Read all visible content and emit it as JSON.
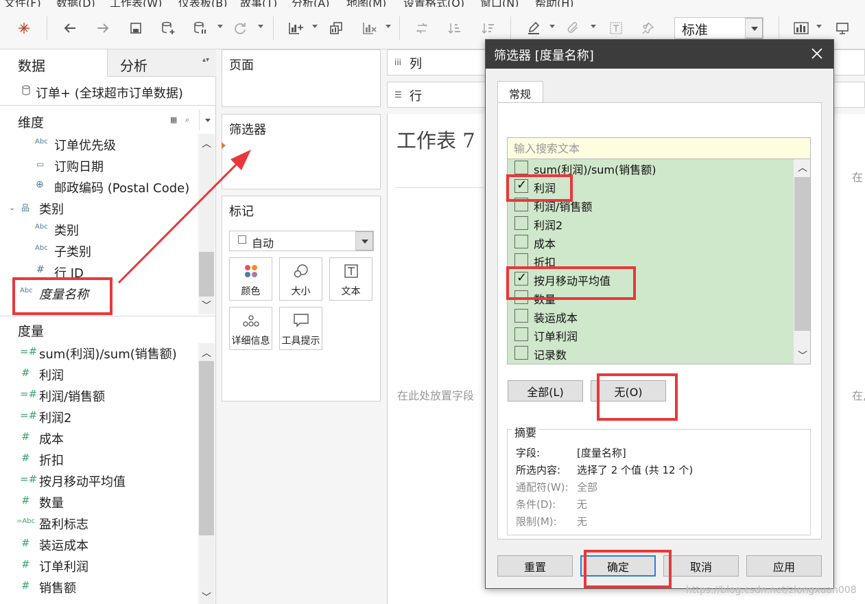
{
  "menubar": {
    "items": [
      "文件(F)",
      "数据(D)",
      "工作表(W)",
      "仪表板(B)",
      "故事(T)",
      "分析(A)",
      "地图(M)",
      "设置格式(O)",
      "窗口(N)",
      "帮助(H)"
    ]
  },
  "toolbar": {
    "icons": [
      "tableau-logo-icon",
      "back-arrow-icon",
      "forward-arrow-icon",
      "save-icon",
      "new-datasource-icon",
      "pause-update-icon",
      "refresh-icon",
      "new-worksheet-icon",
      "duplicate-icon",
      "clear-icon",
      "swap-icon",
      "sort-asc-icon",
      "sort-desc-icon",
      "highlight-icon",
      "annotate-icon",
      "label-icon",
      "pin-icon",
      "show-me-icon",
      "presentation-icon"
    ],
    "fit_select": "标准"
  },
  "left_pane": {
    "tab_data": "数据",
    "tab_analysis": "分析",
    "datasource": "订单+ (全球超市订单数据)",
    "dimensions_title": "维度",
    "dimensions": [
      {
        "icon": "Abc",
        "label": "订单优先级"
      },
      {
        "icon": "calendar",
        "label": "订购日期"
      },
      {
        "icon": "globe",
        "label": "邮政编码 (Postal Code)"
      },
      {
        "icon": "hierarchy",
        "label": "类别"
      },
      {
        "icon": "Abc",
        "label": "类别"
      },
      {
        "icon": "Abc",
        "label": "子类别"
      },
      {
        "icon": "#",
        "label": "行 ID"
      },
      {
        "icon": "Abc",
        "label": "度量名称"
      }
    ],
    "measures_title": "度量",
    "measures": [
      {
        "icon": "=#",
        "label": "sum(利润)/sum(销售额)"
      },
      {
        "icon": "#",
        "label": "利润"
      },
      {
        "icon": "=#",
        "label": "利润/销售额"
      },
      {
        "icon": "=#",
        "label": "利润2"
      },
      {
        "icon": "#",
        "label": "成本"
      },
      {
        "icon": "#",
        "label": "折扣"
      },
      {
        "icon": "=#",
        "label": "按月移动平均值"
      },
      {
        "icon": "#",
        "label": "数量"
      },
      {
        "icon": "=Abc",
        "label": "盈利标志"
      },
      {
        "icon": "#",
        "label": "装运成本"
      },
      {
        "icon": "#",
        "label": "订单利润"
      },
      {
        "icon": "#",
        "label": "销售额"
      }
    ]
  },
  "shelves": {
    "pages": "页面",
    "filters": "筛选器",
    "marks": "标记",
    "marks_type": "自动",
    "mark_cards": [
      "颜色",
      "大小",
      "文本",
      "详细信息",
      "工具提示"
    ],
    "columns": "列",
    "rows": "行"
  },
  "worksheet": {
    "title": "工作表 7",
    "drop_hint": "在此处放置字段",
    "drop_hint_right_top": "在",
    "drop_hint_right": "在,"
  },
  "filter_dialog": {
    "title": "筛选器 [度量名称]",
    "tab": "常规",
    "search_placeholder": "输入搜索文本",
    "items": [
      {
        "label": "sum(利润)/sum(销售额)",
        "checked": false
      },
      {
        "label": "利润",
        "checked": true
      },
      {
        "label": "利润/销售额",
        "checked": false
      },
      {
        "label": "利润2",
        "checked": false
      },
      {
        "label": "成本",
        "checked": false
      },
      {
        "label": "折扣",
        "checked": false
      },
      {
        "label": "按月移动平均值",
        "checked": true
      },
      {
        "label": "数量",
        "checked": false
      },
      {
        "label": "装运成本",
        "checked": false
      },
      {
        "label": "订单利润",
        "checked": false
      },
      {
        "label": "记录数",
        "checked": false
      }
    ],
    "btn_all": "全部(L)",
    "btn_none": "无(O)",
    "summary_title": "摘要",
    "summary": {
      "field_key": "字段:",
      "field_val": "[度量名称]",
      "selected_key": "所选内容:",
      "selected_val": "选择了 2 个值 (共 12 个)",
      "wildcard_key": "通配符(W):",
      "wildcard_val": "全部",
      "condition_key": "条件(D):",
      "condition_val": "无",
      "limit_key": "限制(M):",
      "limit_val": "无"
    },
    "btn_reset": "重置",
    "btn_ok": "确定",
    "btn_cancel": "取消",
    "btn_apply": "应用"
  },
  "watermark": "https://blog.csdn.net/zlongxuan008",
  "colors": {
    "annotation_red": "#e8383b",
    "list_bg": "#cfe7cb",
    "search_bg": "#fffde0",
    "dialog_title_bg": "#3c3c3c",
    "ok_border": "#2b7fd9"
  }
}
